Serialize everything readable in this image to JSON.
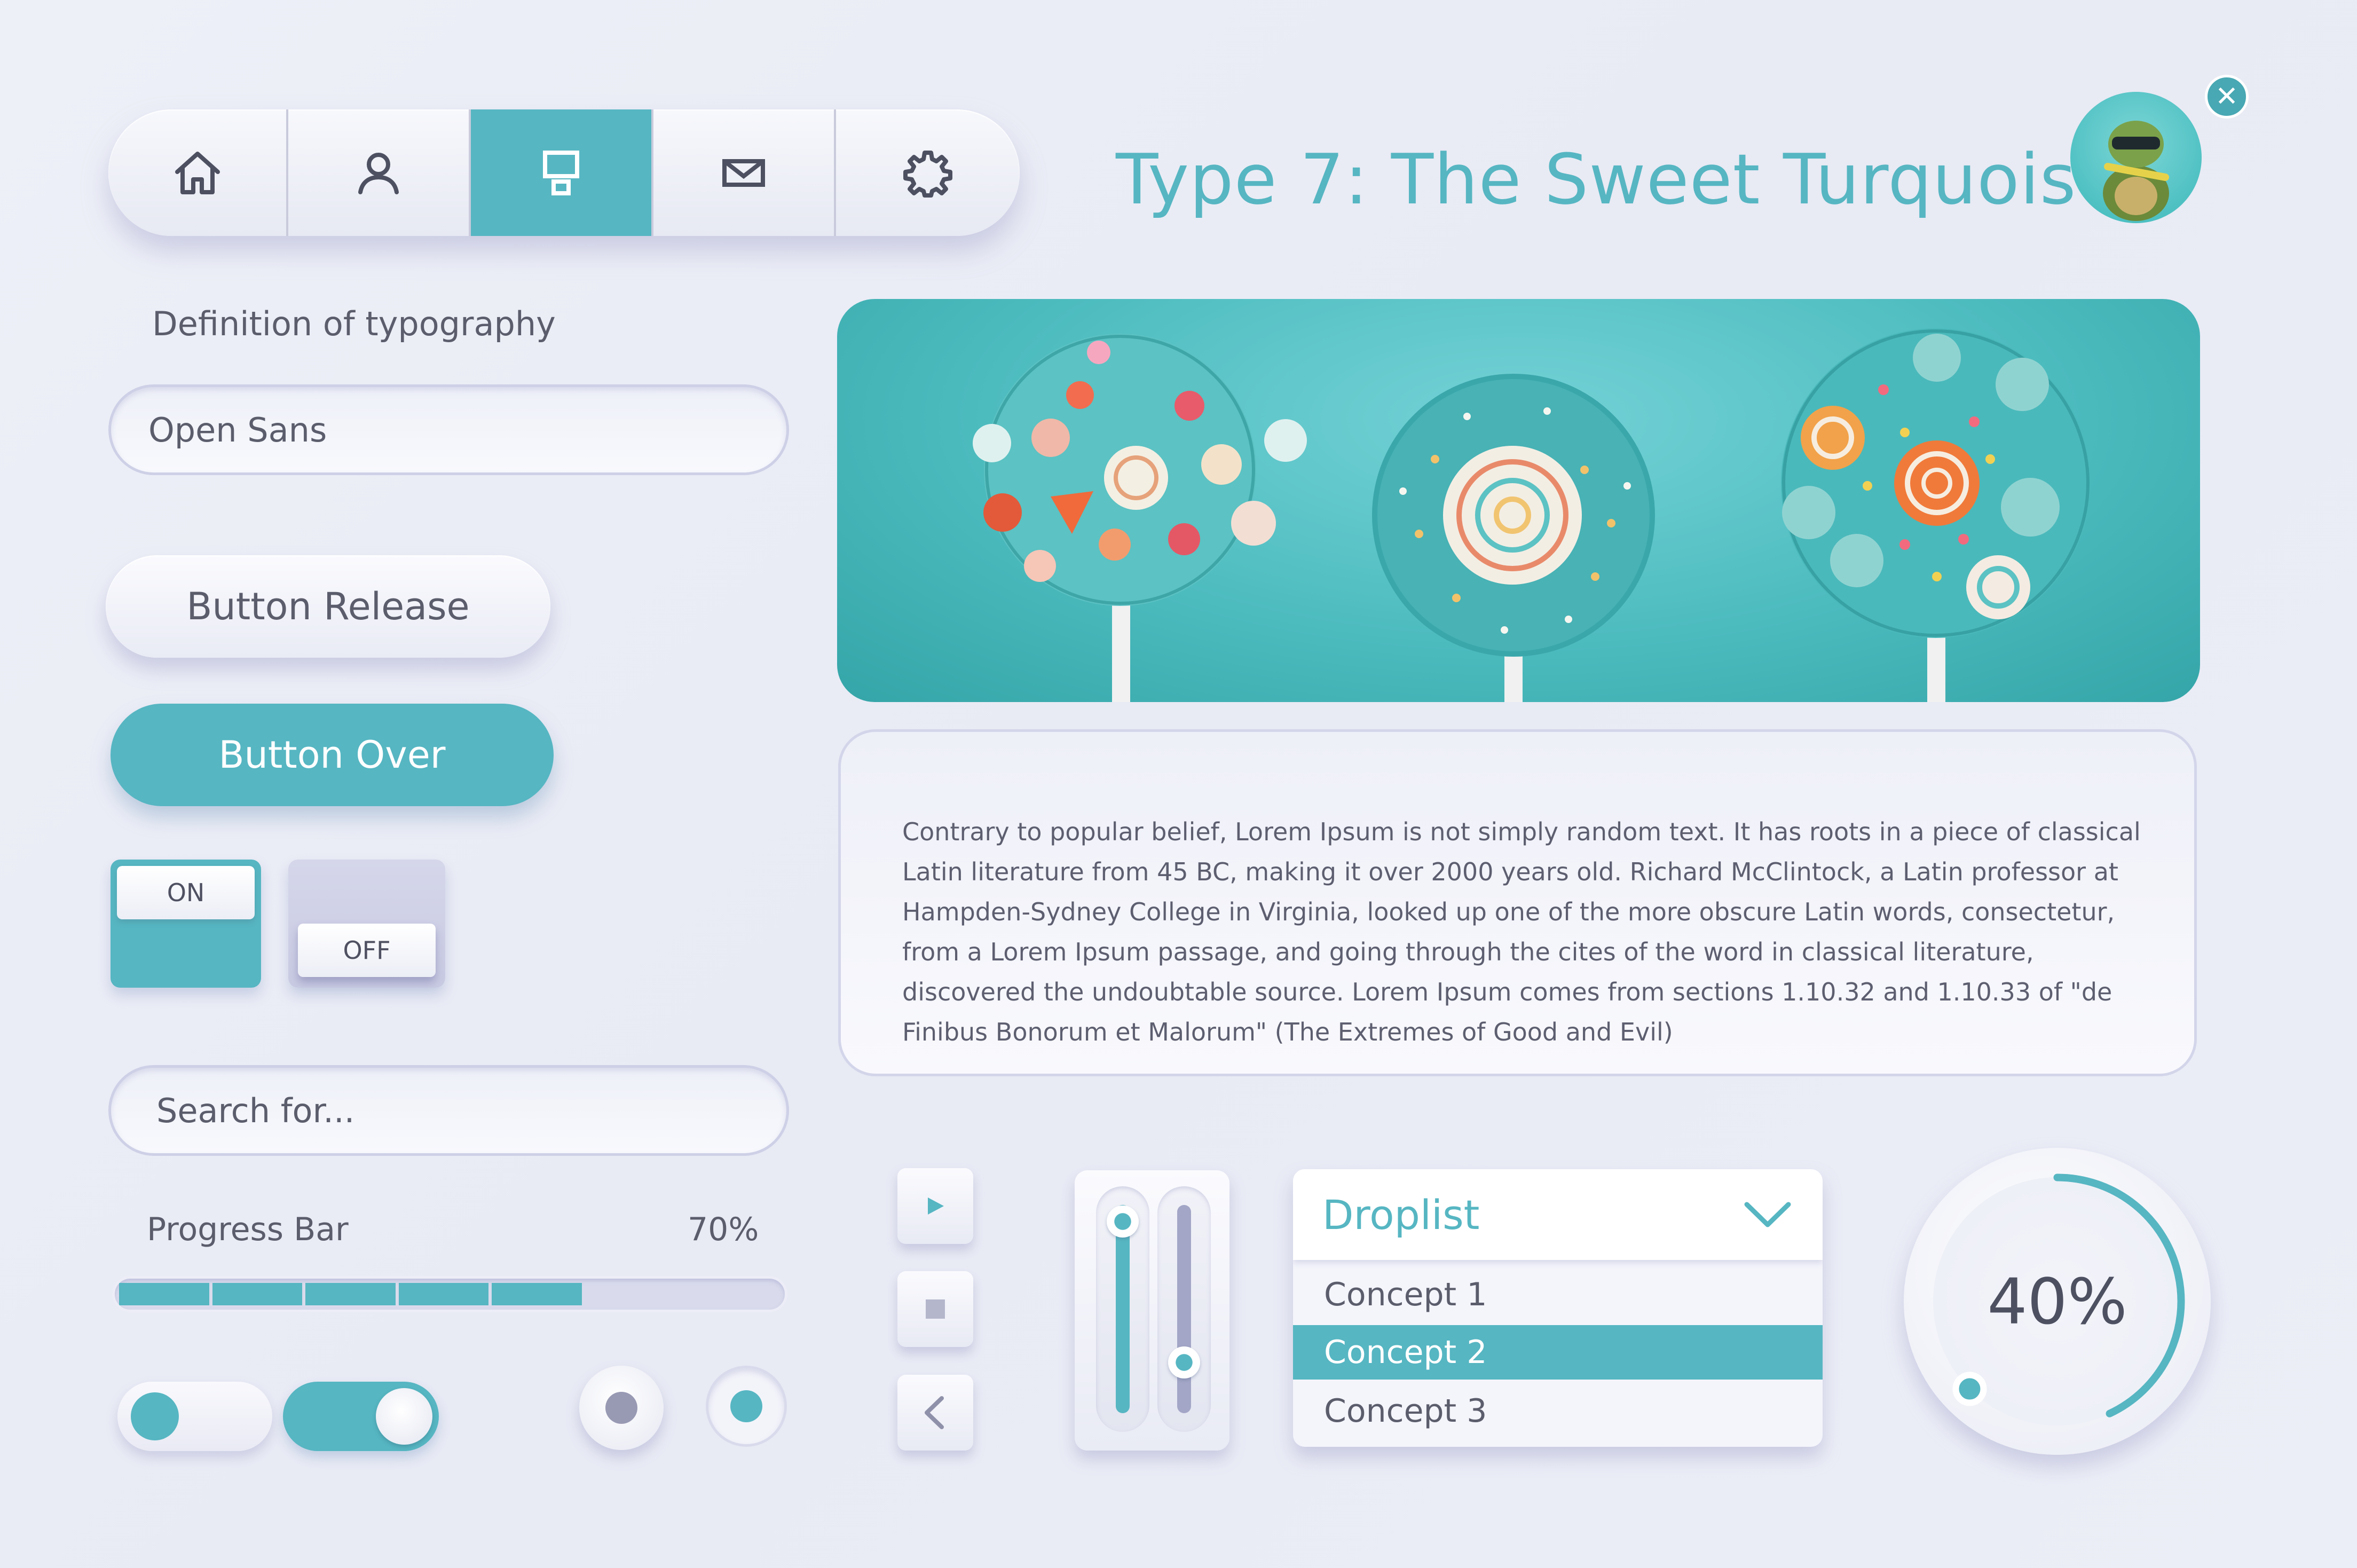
{
  "nav": {
    "items": [
      {
        "icon": "home-icon",
        "width": 1
      },
      {
        "icon": "user-icon",
        "width": 1
      },
      {
        "icon": "layout-icon",
        "width": 1
      },
      {
        "icon": "mail-icon",
        "width": 1
      },
      {
        "icon": "gear-icon",
        "width": 1
      }
    ],
    "active_index": 2
  },
  "title": "Type 7: The Sweet Turquoise",
  "avatar": {
    "icon": "turtle-avatar-icon"
  },
  "close": {
    "icon": "close-icon",
    "label": "✕"
  },
  "typography": {
    "label": "Definition of typography",
    "font_value": "Open Sans"
  },
  "buttons": {
    "release_label": "Button Release",
    "over_label": "Button Over"
  },
  "toggles": {
    "on_label": "ON",
    "off_label": "OFF"
  },
  "search": {
    "placeholder": "Search for..."
  },
  "progress": {
    "label": "Progress Bar",
    "value_text": "70%",
    "value": 0.7,
    "segments": 5
  },
  "switches": [
    {
      "state": "off"
    },
    {
      "state": "on"
    }
  ],
  "radios": [
    {
      "selected": false
    },
    {
      "selected": true
    }
  ],
  "banner": {
    "image": "turquoise-lollipops-image"
  },
  "paragraph": "Contrary to popular belief, Lorem Ipsum is not simply random text. It has roots in a piece of classical Latin literature from 45 BC, making it over 2000 years old. Richard McClintock, a Latin professor at Hampden-Sydney College in Virginia, looked up one of the more obscure Latin words, consectetur, from a Lorem Ipsum passage, and going through the cites of the word in classical literature, discovered the undoubtable source. Lorem Ipsum comes from sections 1.10.32 and 1.10.33 of \"de Finibus Bonorum et Malorum\" (The Extremes of Good and Evil)",
  "media": {
    "play_icon": "play-icon",
    "stop_icon": "stop-icon",
    "back_icon": "chevron-left-icon"
  },
  "sliders": [
    {
      "level": 0.95
    },
    {
      "level": 0.25
    }
  ],
  "droplist": {
    "title": "Droplist",
    "options": [
      "Concept 1",
      "Concept 2",
      "Concept 3"
    ],
    "selected_index": 1
  },
  "gauge": {
    "value_text": "40%",
    "value": 0.4
  },
  "colors": {
    "accent": "#56b6c2",
    "background": "#eceef7",
    "text": "#5b5d6c",
    "inactive": "#9899b3"
  }
}
